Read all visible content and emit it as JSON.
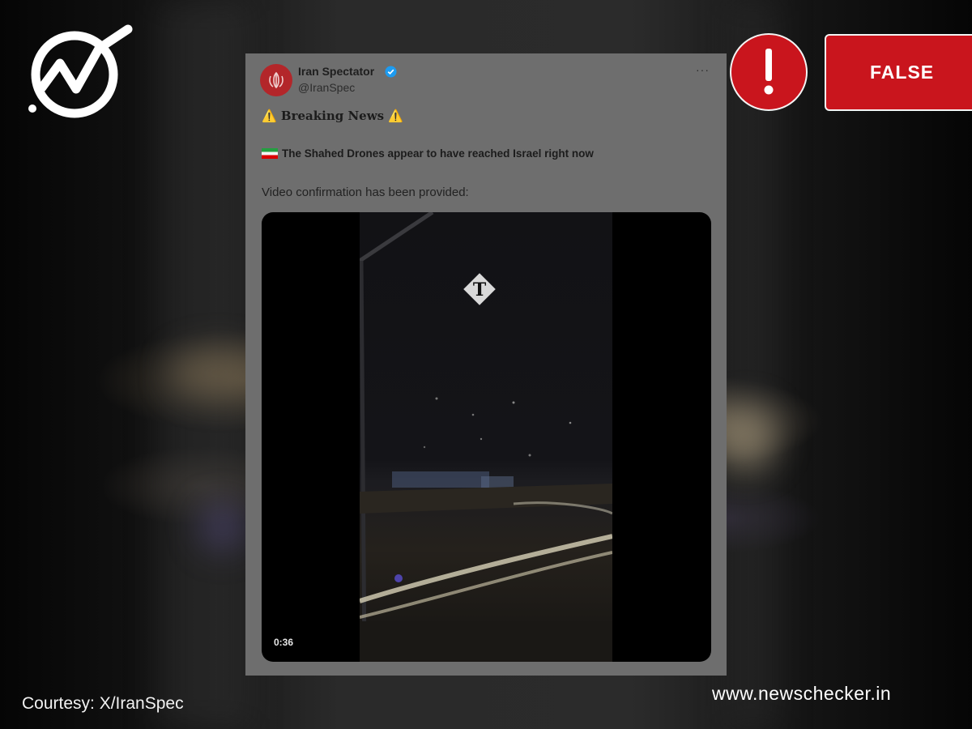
{
  "overlay": {
    "verdict": "FALSE",
    "alert_symbol": "!",
    "courtesy": "Courtesy: X/IranSpec",
    "site": "www.newschecker.in"
  },
  "tweet": {
    "author_name": "Iran Spectator",
    "author_handle": "@IranSpec",
    "more_menu": "···",
    "headline_warn_left": "⚠️",
    "headline": "Breaking News",
    "headline_warn_right": "⚠️",
    "claim": "The Shahed Drones appear to have reached Israel right now",
    "confirmation": "Video confirmation has been provided:",
    "video": {
      "duration": "0:36",
      "watermark": "T"
    }
  },
  "icons": {
    "logo": "newschecker-logo-icon",
    "alert": "exclamation-icon",
    "verified": "verified-badge-icon",
    "flag": "iran-flag-icon",
    "warning": "warning-icon"
  },
  "colors": {
    "verdict_red": "#c9151d",
    "verified_blue": "#1d9bf0"
  }
}
